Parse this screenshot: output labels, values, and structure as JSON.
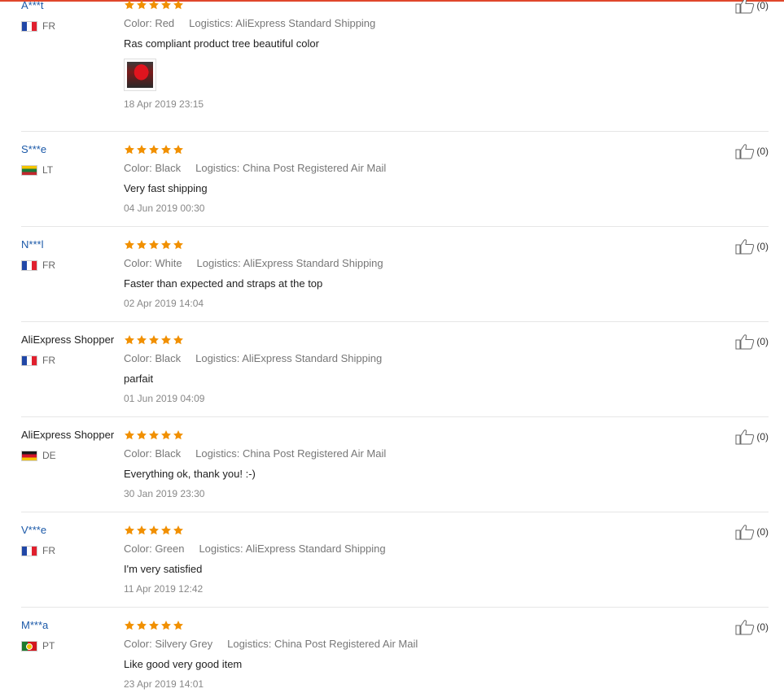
{
  "colors": {
    "accent_rule": "#e0472b",
    "username_link": "#1b59a8",
    "star": "#f19000",
    "divider": "#e6e6e6"
  },
  "reviews": [
    {
      "user": "A***t",
      "country": "FR",
      "rating": 5,
      "color_label": "Color:",
      "color_value": "Red",
      "logistics_label": "Logistics:",
      "logistics_value": "AliExpress Standard Shipping",
      "text": "Ras compliant product tree beautiful color",
      "has_photo": true,
      "date": "18 Apr 2019 23:15",
      "helpful": "(0)"
    },
    {
      "user": "S***e",
      "country": "LT",
      "rating": 5,
      "color_label": "Color:",
      "color_value": "Black",
      "logistics_label": "Logistics:",
      "logistics_value": "China Post Registered Air Mail",
      "text": "Very fast shipping",
      "date": "04 Jun 2019 00:30",
      "helpful": "(0)"
    },
    {
      "user": "N***l",
      "country": "FR",
      "rating": 5,
      "color_label": "Color:",
      "color_value": "White",
      "logistics_label": "Logistics:",
      "logistics_value": "AliExpress Standard Shipping",
      "text": "Faster than expected and straps at the top",
      "date": "02 Apr 2019 14:04",
      "helpful": "(0)"
    },
    {
      "user": "AliExpress Shopper",
      "country": "FR",
      "rating": 5,
      "color_label": "Color:",
      "color_value": "Black",
      "logistics_label": "Logistics:",
      "logistics_value": "AliExpress Standard Shipping",
      "text": "parfait",
      "date": "01 Jun 2019 04:09",
      "helpful": "(0)"
    },
    {
      "user": "AliExpress Shopper",
      "country": "DE",
      "rating": 5,
      "color_label": "Color:",
      "color_value": "Black",
      "logistics_label": "Logistics:",
      "logistics_value": "China Post Registered Air Mail",
      "text": "Everything ok, thank you! :-)",
      "date": "30 Jan 2019 23:30",
      "helpful": "(0)"
    },
    {
      "user": "V***e",
      "country": "FR",
      "rating": 5,
      "color_label": "Color:",
      "color_value": "Green",
      "logistics_label": "Logistics:",
      "logistics_value": "AliExpress Standard Shipping",
      "text": "I'm very satisfied",
      "date": "11 Apr 2019 12:42",
      "helpful": "(0)"
    },
    {
      "user": "M***a",
      "country": "PT",
      "rating": 5,
      "color_label": "Color:",
      "color_value": "Silvery Grey",
      "logistics_label": "Logistics:",
      "logistics_value": "China Post Registered Air Mail",
      "text": "Like good very good item",
      "date": "23 Apr 2019 14:01",
      "helpful": "(0)"
    }
  ]
}
